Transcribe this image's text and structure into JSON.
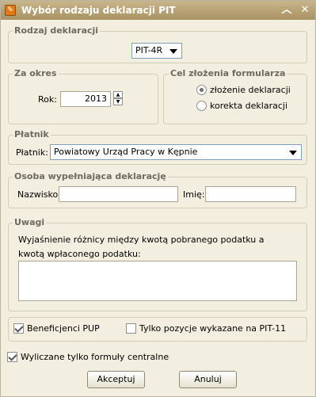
{
  "window": {
    "title": "Wybór rodzaju deklaracji PIT",
    "app_icon": "document-pen-icon",
    "minimize_glyph": "︿",
    "close_glyph": "✕"
  },
  "rodzaj": {
    "title": "Rodzaj deklaracji",
    "selected": "PIT-4R"
  },
  "okres": {
    "title": "Za okres",
    "rok_label": "Rok:",
    "rok_value": "2013",
    "spin_up": "▲",
    "spin_down": "▼"
  },
  "cel": {
    "title": "Cel złożenia formularza",
    "opt1": "złożenie deklaracji",
    "opt2": "korekta deklaracji"
  },
  "platnik": {
    "title": "Płatnik",
    "label": "Płatnik:",
    "selected": "Powiatowy Urząd Pracy w Kępnie"
  },
  "osoba": {
    "title": "Osoba wypełniająca deklarację",
    "nazwisko_label": "Nazwisko:",
    "nazwisko_value": "",
    "imie_label": "Imię:",
    "imie_value": ""
  },
  "uwagi": {
    "title": "Uwagi",
    "text": "Wyjaśnienie różnicy między kwotą pobranego podatku a kwotą wpłaconego podatku:",
    "value": ""
  },
  "opcje": {
    "beneficjenci": "Beneficjenci PUP",
    "tylko_pit11": "Tylko pozycje wykazane na PIT-11"
  },
  "formuly": {
    "label": "Wyliczane tylko formuły centralne"
  },
  "buttons": {
    "accept": "Akceptuj",
    "cancel": "Anuluj"
  }
}
